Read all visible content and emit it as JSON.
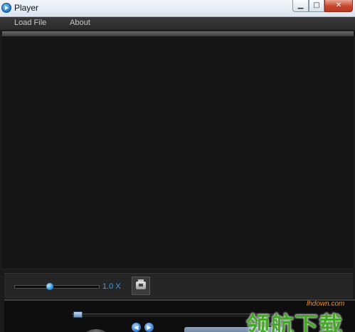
{
  "window": {
    "title": "Player",
    "controls": {
      "minimize": "▁",
      "maximize": "□",
      "close": "✕"
    }
  },
  "menu": {
    "items": [
      {
        "label": "Load File"
      },
      {
        "label": "About"
      }
    ]
  },
  "controls": {
    "speed_value": "1.0 X",
    "speed_slider_fraction": 0.42,
    "playback_progress_fraction": 0.0,
    "prev_icon": "◀",
    "next_icon": "▶"
  },
  "icons": {
    "app": "play-icon",
    "snapshot": "camera-icon"
  },
  "colors": {
    "accent": "#3b9de8",
    "background": "#1b1b1b",
    "watermark_green": "#43a825",
    "watermark_orange": "#ff8c1a"
  },
  "watermark": {
    "url": "lhdown.com",
    "text": "领航下载"
  }
}
